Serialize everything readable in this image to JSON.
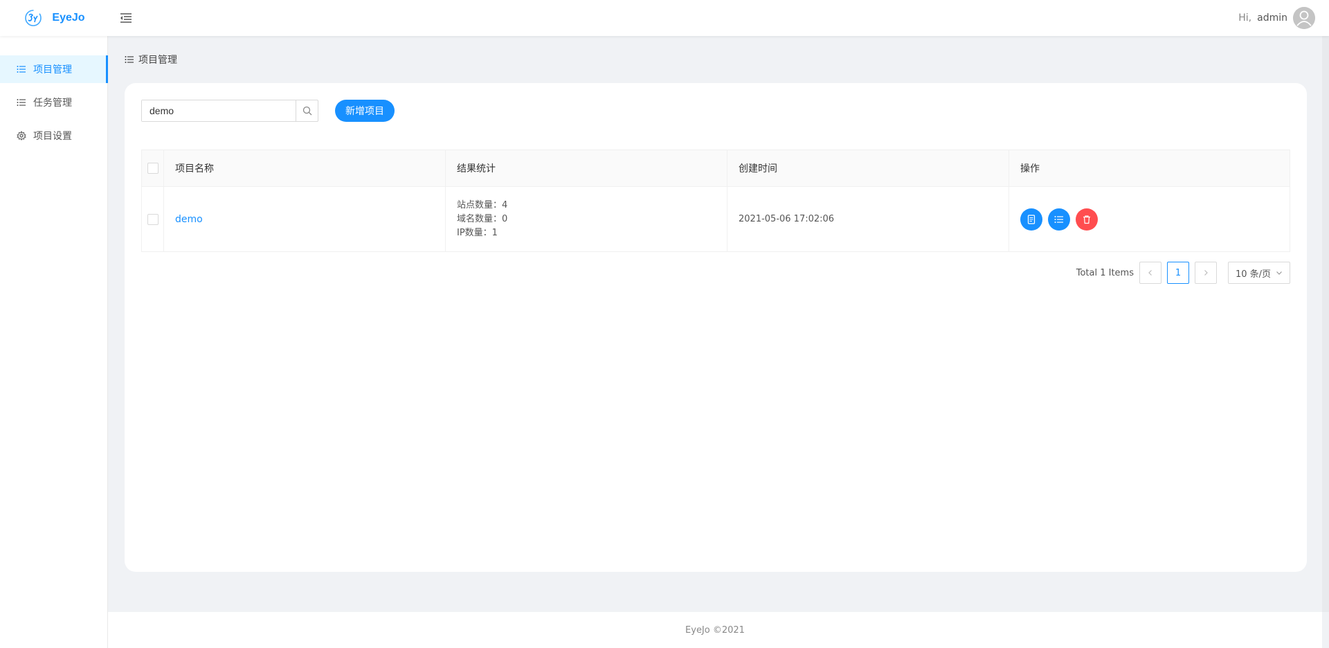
{
  "app": {
    "brand": "EyeJo"
  },
  "header": {
    "greeting": "Hi,",
    "username": "admin"
  },
  "sidebar": {
    "items": [
      {
        "label": "项目管理",
        "icon": "list-icon",
        "active": true
      },
      {
        "label": "任务管理",
        "icon": "list-icon",
        "active": false
      },
      {
        "label": "项目设置",
        "icon": "gear-icon",
        "active": false
      }
    ]
  },
  "breadcrumb": {
    "label": "项目管理"
  },
  "toolbar": {
    "search_value": "demo",
    "add_label": "新增项目"
  },
  "table": {
    "columns": [
      "项目名称",
      "结果统计",
      "创建时间",
      "操作"
    ],
    "rows": [
      {
        "name": "demo",
        "stats": [
          "站点数量：4",
          "域名数量：0",
          "IP数量：1"
        ],
        "created": "2021-05-06 17:02:06"
      }
    ]
  },
  "pagination": {
    "total": "Total 1 Items",
    "current": "1",
    "page_size": "10 条/页"
  },
  "footer": {
    "text": "EyeJo ©2021"
  },
  "colors": {
    "primary": "#1890ff",
    "danger": "#ff4d4f"
  }
}
